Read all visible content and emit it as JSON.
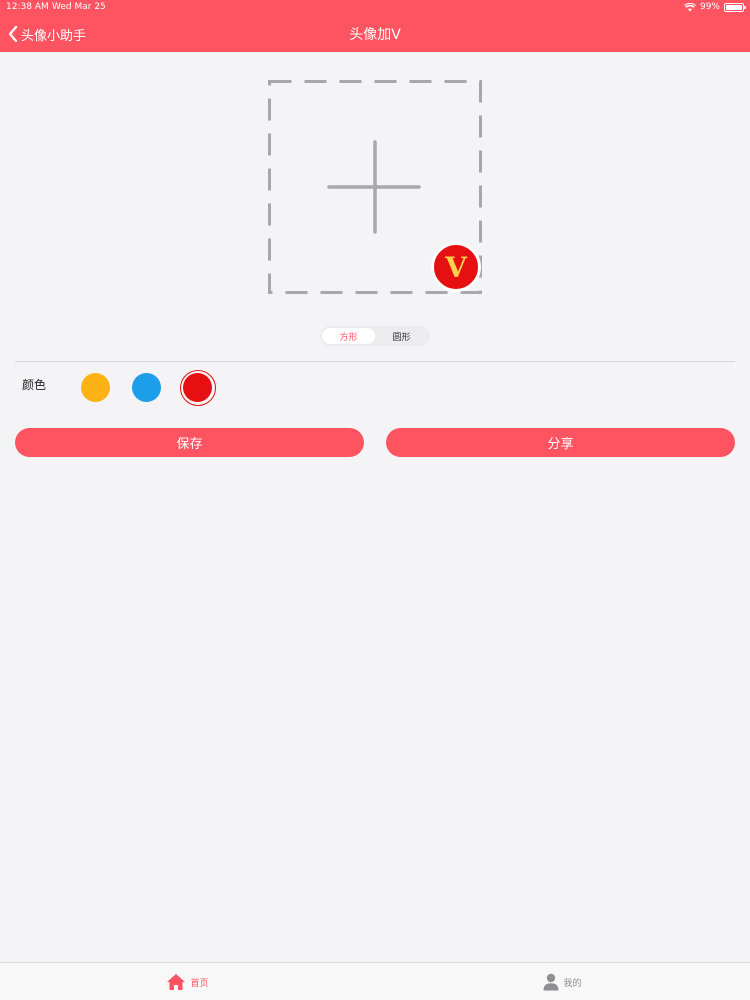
{
  "status_bar": {
    "time": "12:38 AM",
    "date": "Wed Mar 25",
    "battery": "99%"
  },
  "nav": {
    "back_label": "头像小助手",
    "title": "头像加V"
  },
  "badge": {
    "letter": "V"
  },
  "shape_toggle": {
    "options": [
      "方形",
      "圆形"
    ],
    "selected": "方形"
  },
  "color_picker": {
    "label": "颜色",
    "swatches": [
      "#fdb215",
      "#1c9eea",
      "#e60f12"
    ],
    "selected": "#e60f12"
  },
  "actions": {
    "save_label": "保存",
    "share_label": "分享"
  },
  "tab_bar": {
    "items": [
      {
        "label": "首页",
        "icon": "home-icon",
        "active": true
      },
      {
        "label": "我的",
        "icon": "user-icon",
        "active": false
      }
    ]
  },
  "colors": {
    "accent": "#fe5461",
    "background": "#f4f4f6",
    "inactive": "#8e8e93"
  }
}
